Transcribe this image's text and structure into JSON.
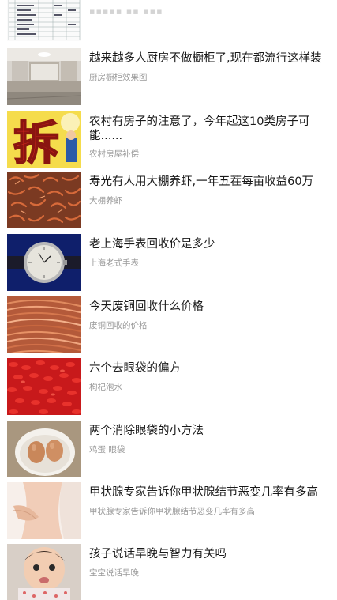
{
  "feed": {
    "items": [
      {
        "title": "越来越多人厨房不做橱柜了,现在都流行这样装",
        "tag": "厨房橱柜效果图",
        "thumb": "kitchen-photo"
      },
      {
        "title": "农村有房子的注意了，今年起这10类房子可能......",
        "tag": "农村房屋补偿",
        "thumb": "demolish-character-image"
      },
      {
        "title": "寿光有人用大棚养虾,一年五茬每亩收益60万",
        "tag": "大棚养虾",
        "thumb": "shrimp-pile-photo"
      },
      {
        "title": "老上海手表回收价是多少",
        "tag": "上海老式手表",
        "thumb": "wristwatch-photo"
      },
      {
        "title": "今天废铜回收什么价格",
        "tag": "废铜回收的价格",
        "thumb": "copper-wire-photo"
      },
      {
        "title": "六个去眼袋的偏方",
        "tag": "枸杞泡水",
        "thumb": "goji-berries-photo"
      },
      {
        "title": "两个消除眼袋的小方法",
        "tag": "鸡蛋 眼袋",
        "thumb": "eggs-in-bowl-photo"
      },
      {
        "title": "甲状腺专家告诉你甲状腺结节恶变几率有多高",
        "tag": "甲状腺专家告诉你甲状腺结节恶变几率有多高",
        "thumb": "neck-photo"
      },
      {
        "title": "孩子说话早晚与智力有关吗",
        "tag": "宝宝说话早晚",
        "thumb": "baby-photo"
      }
    ]
  }
}
